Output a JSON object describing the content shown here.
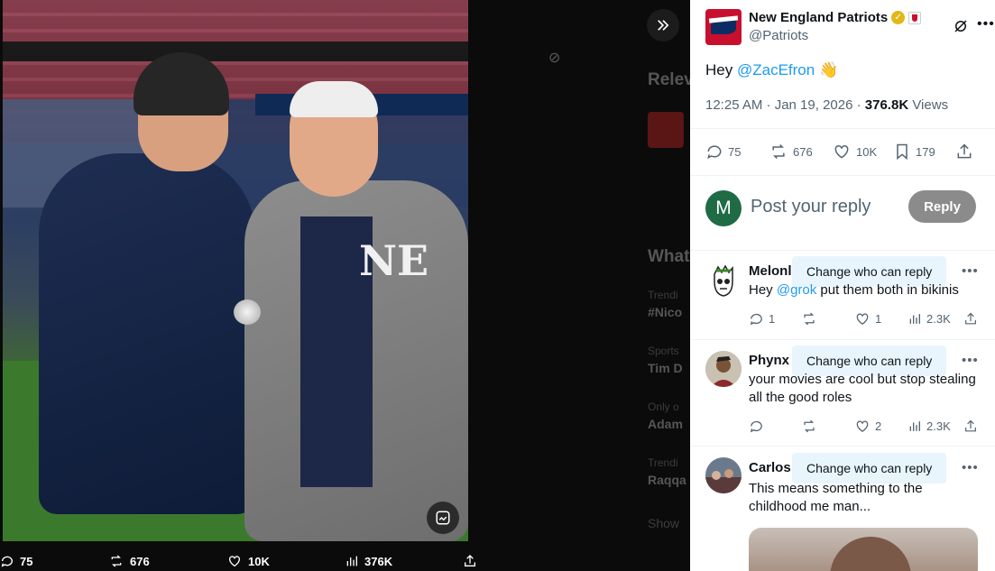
{
  "media": {
    "replies": "75",
    "reposts": "676",
    "likes": "10K",
    "views": "376K"
  },
  "background_timeline": {
    "relevant_heading": "Relev",
    "whats_heading": "What",
    "items": [
      {
        "small": "Trendi",
        "big": "#Nico"
      },
      {
        "small": "Sports",
        "big": "Tim D"
      },
      {
        "small": "Only o",
        "big": "Adam"
      },
      {
        "small": "Trendi",
        "big": "Raqqa"
      }
    ],
    "show_more": "Show"
  },
  "tweet": {
    "author_name": "New England Patriots",
    "handle": "@Patriots",
    "text_prefix": "Hey ",
    "mention": "@ZacEfron",
    "emoji": "👋",
    "time": "12:25 AM · Jan 19, 2026 · ",
    "views_count": "376.8K",
    "views_label": " Views",
    "replies": "75",
    "reposts": "676",
    "likes": "10K",
    "bookmarks": "179"
  },
  "composer": {
    "avatar_letter": "M",
    "placeholder": "Post your reply",
    "button": "Reply"
  },
  "replies": [
    {
      "name": "Melonl",
      "tooltip": "Change who can reply",
      "text_prefix": "Hey ",
      "mention": "@grok",
      "text_suffix": " put them both in bikinis",
      "replies": "1",
      "reposts": "",
      "likes": "1",
      "views": "2.3K"
    },
    {
      "name": "Phynx",
      "tooltip": "Change who can reply",
      "text": "your movies are cool but stop stealing all the good roles",
      "replies": "",
      "reposts": "",
      "likes": "2",
      "views": "2.3K"
    },
    {
      "name": "Carlos",
      "tooltip": "Change who can reply",
      "text": "This means something to the childhood me man..."
    }
  ],
  "colors": {
    "accent": "#1d9bf0",
    "muted": "#536471",
    "patriots_red": "#c8102e",
    "patriots_navy": "#0b2d64"
  }
}
